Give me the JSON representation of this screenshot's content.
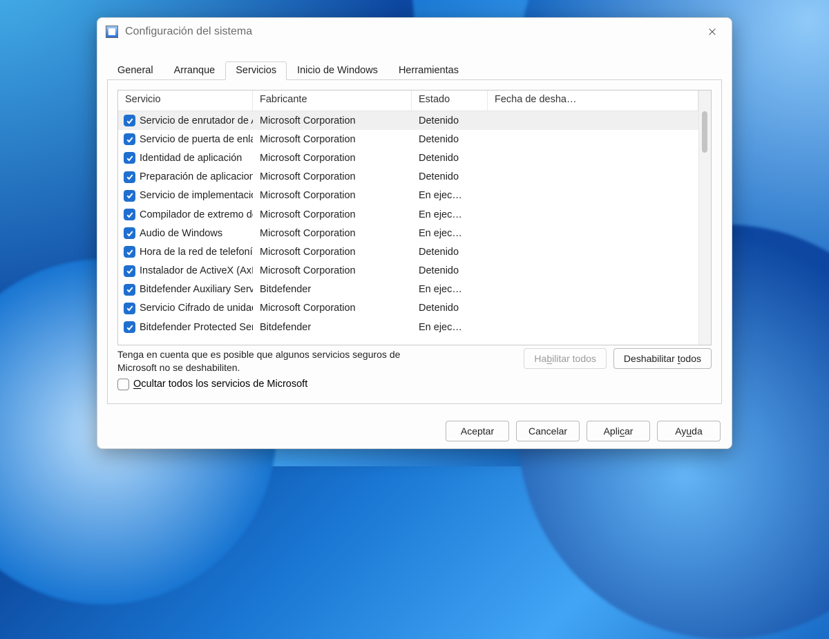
{
  "window": {
    "title": "Configuración del sistema"
  },
  "tabs": {
    "general": "General",
    "boot": "Arranque",
    "services": "Servicios",
    "startup": "Inicio de Windows",
    "tools": "Herramientas",
    "active": "services"
  },
  "columns": {
    "service": "Servicio",
    "manufacturer": "Fabricante",
    "status": "Estado",
    "disabled_date": "Fecha de desha…"
  },
  "services": [
    {
      "checked": true,
      "name": "Servicio de enrutador de AllJoyn",
      "manufacturer": "Microsoft Corporation",
      "status": "Detenido"
    },
    {
      "checked": true,
      "name": "Servicio de puerta de enlace de …",
      "manufacturer": "Microsoft Corporation",
      "status": "Detenido"
    },
    {
      "checked": true,
      "name": "Identidad de aplicación",
      "manufacturer": "Microsoft Corporation",
      "status": "Detenido"
    },
    {
      "checked": true,
      "name": "Preparación de aplicaciones",
      "manufacturer": "Microsoft Corporation",
      "status": "Detenido"
    },
    {
      "checked": true,
      "name": "Servicio de implementación de A…",
      "manufacturer": "Microsoft Corporation",
      "status": "En ejec…"
    },
    {
      "checked": true,
      "name": "Compilador de extremo de audio…",
      "manufacturer": "Microsoft Corporation",
      "status": "En ejec…"
    },
    {
      "checked": true,
      "name": "Audio de Windows",
      "manufacturer": "Microsoft Corporation",
      "status": "En ejec…"
    },
    {
      "checked": true,
      "name": "Hora de la red de telefonía móvil",
      "manufacturer": "Microsoft Corporation",
      "status": "Detenido"
    },
    {
      "checked": true,
      "name": "Instalador de ActiveX (AxInstSV)",
      "manufacturer": "Microsoft Corporation",
      "status": "Detenido"
    },
    {
      "checked": true,
      "name": "Bitdefender Auxiliary Service",
      "manufacturer": "Bitdefender",
      "status": "En ejec…"
    },
    {
      "checked": true,
      "name": "Servicio Cifrado de unidad BitLoc…",
      "manufacturer": "Microsoft Corporation",
      "status": "Detenido"
    },
    {
      "checked": true,
      "name": "Bitdefender Protected Service",
      "manufacturer": "Bitdefender",
      "status": "En ejec…"
    }
  ],
  "warning": "Tenga en cuenta que es posible que algunos servicios seguros de Microsoft no se deshabiliten.",
  "hide_ms_pre": "O",
  "hide_ms": "cultar todos los servicios de Microsoft",
  "buttons": {
    "enable_pre": "Ha",
    "enable_u": "b",
    "enable_post": "ilitar todos",
    "disable_pre": "Deshabilitar ",
    "disable_u": "t",
    "disable_post": "odos",
    "accept": "Aceptar",
    "cancel": "Cancelar",
    "apply_pre": "Apli",
    "apply_u": "c",
    "apply_post": "ar",
    "help_pre": "Ay",
    "help_u": "u",
    "help_post": "da"
  }
}
